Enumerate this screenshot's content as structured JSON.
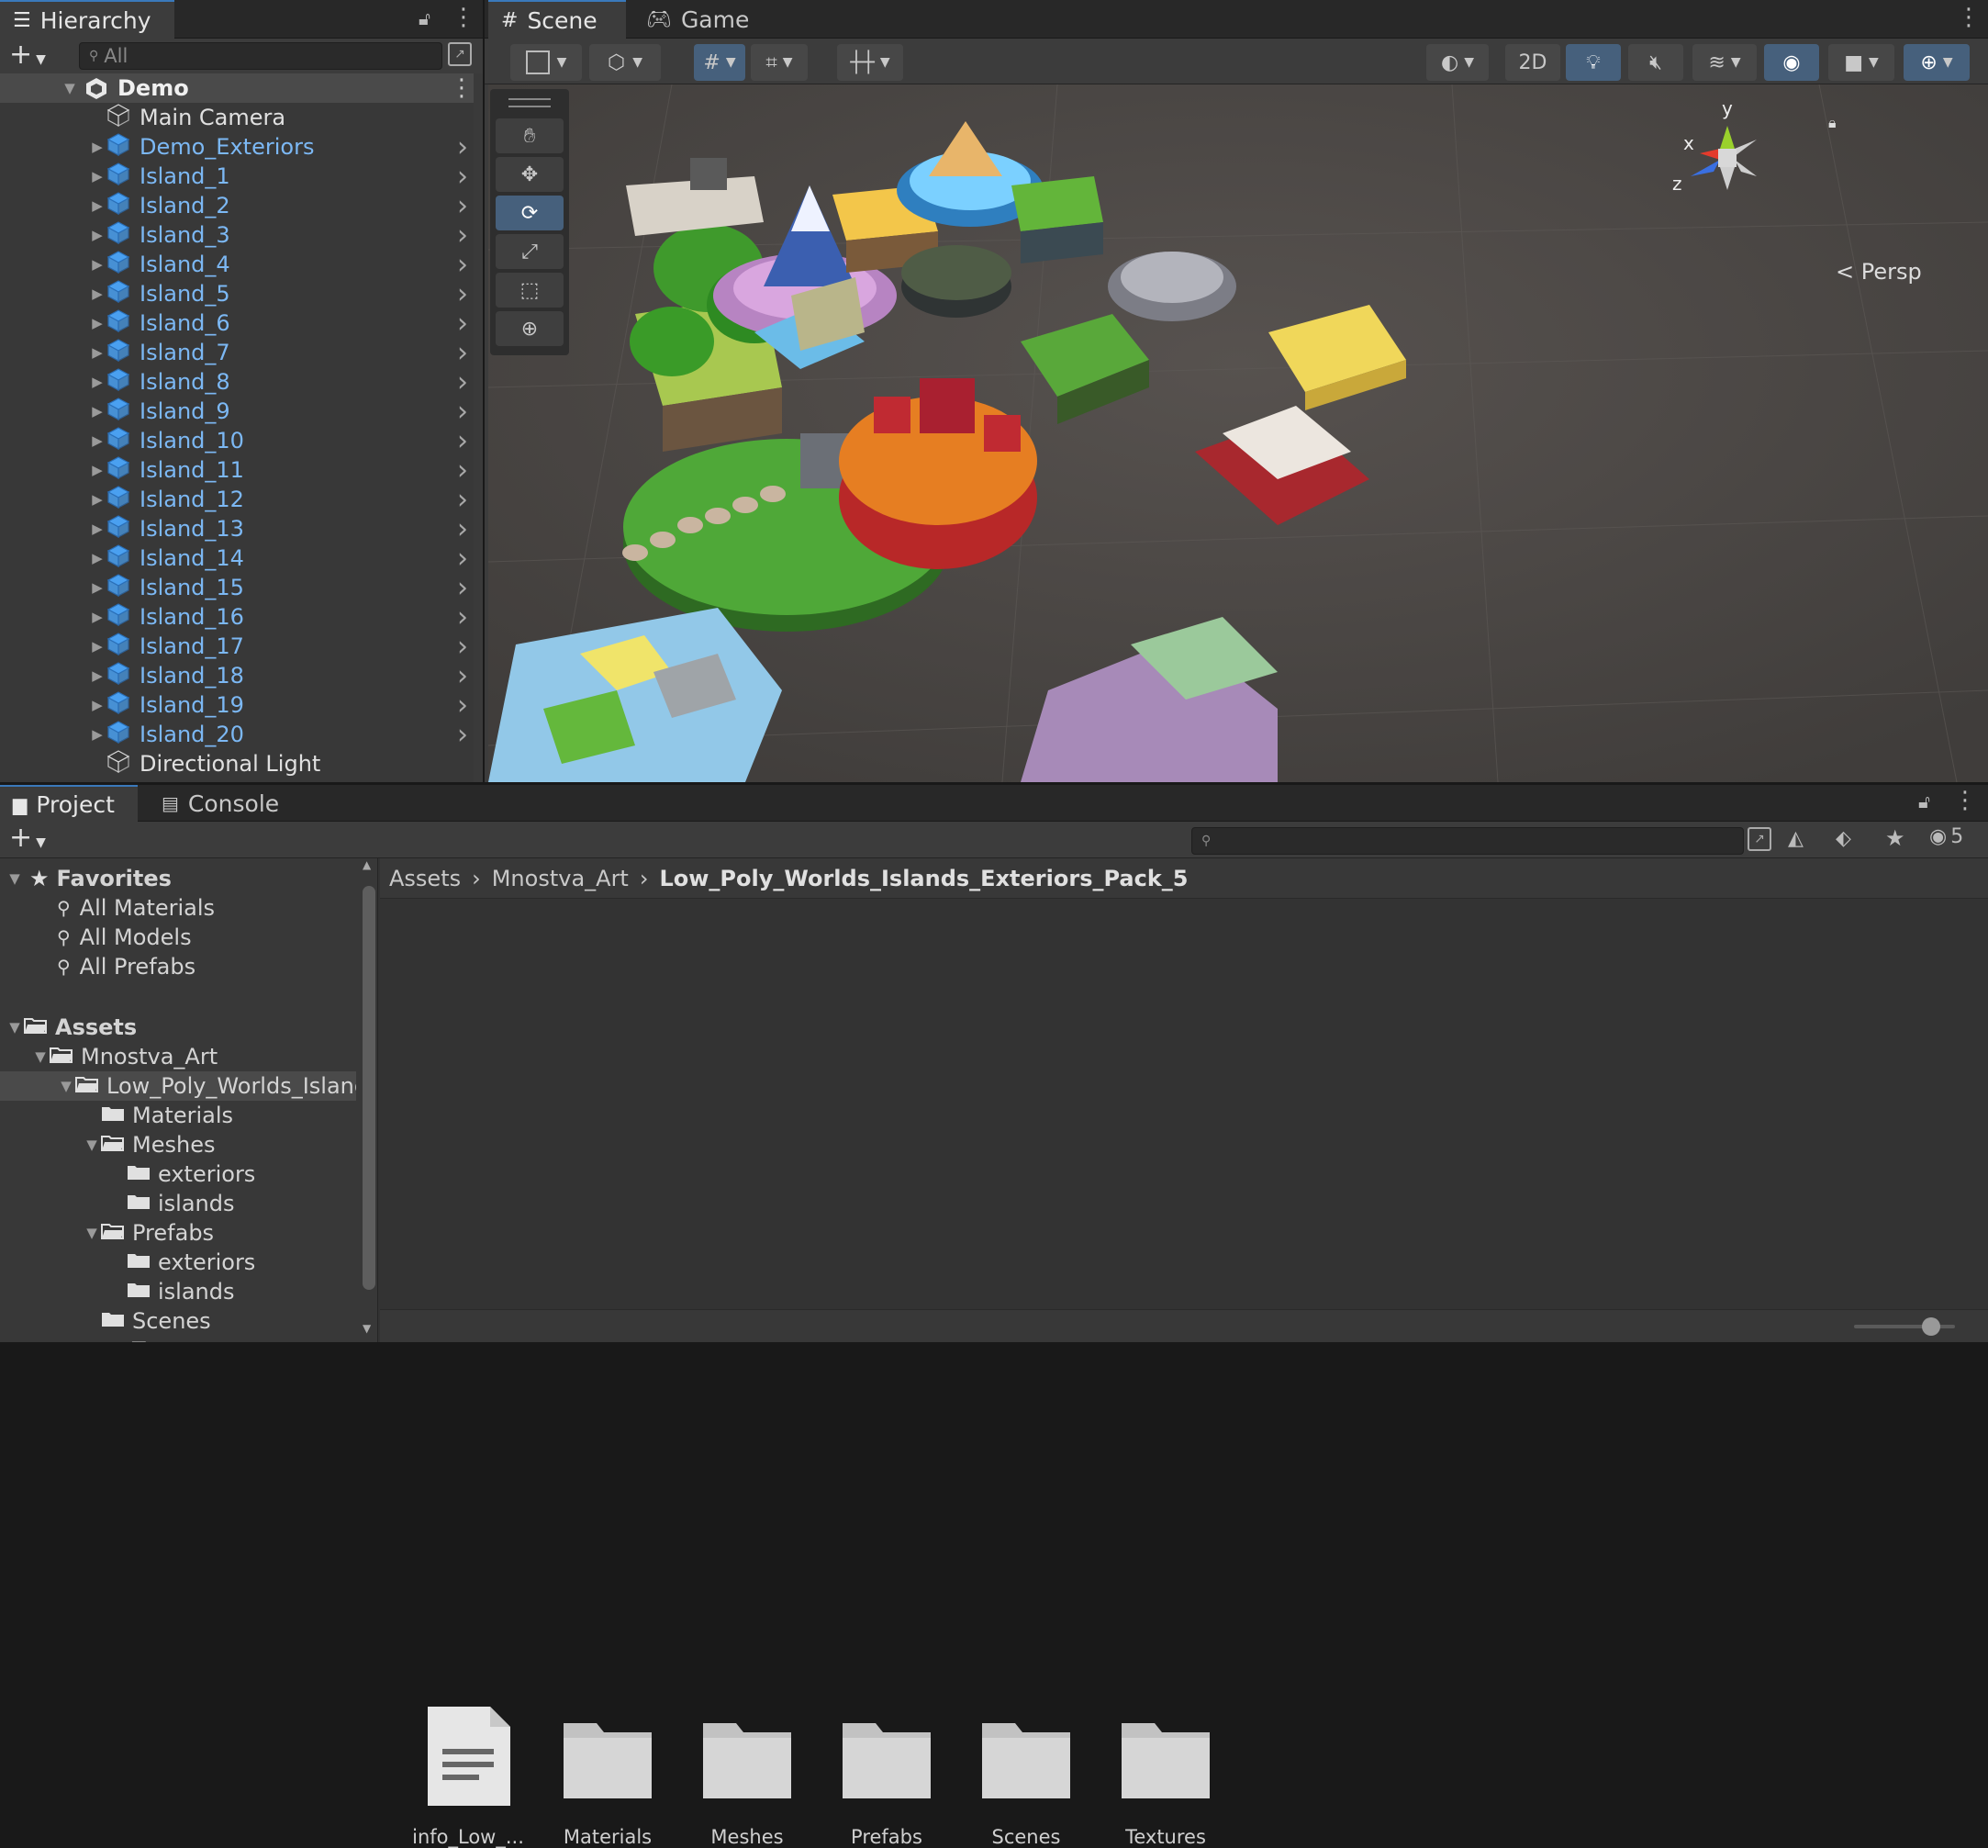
{
  "hierarchy": {
    "tab_label": "Hierarchy",
    "search_placeholder": "All",
    "root": "Demo",
    "items": [
      {
        "label": "Main Camera",
        "kind": "white"
      },
      {
        "label": "Demo_Exteriors",
        "kind": "prefab"
      },
      {
        "label": "Island_1",
        "kind": "prefab"
      },
      {
        "label": "Island_2",
        "kind": "prefab"
      },
      {
        "label": "Island_3",
        "kind": "prefab"
      },
      {
        "label": "Island_4",
        "kind": "prefab"
      },
      {
        "label": "Island_5",
        "kind": "prefab"
      },
      {
        "label": "Island_6",
        "kind": "prefab"
      },
      {
        "label": "Island_7",
        "kind": "prefab"
      },
      {
        "label": "Island_8",
        "kind": "prefab"
      },
      {
        "label": "Island_9",
        "kind": "prefab"
      },
      {
        "label": "Island_10",
        "kind": "prefab"
      },
      {
        "label": "Island_11",
        "kind": "prefab"
      },
      {
        "label": "Island_12",
        "kind": "prefab"
      },
      {
        "label": "Island_13",
        "kind": "prefab"
      },
      {
        "label": "Island_14",
        "kind": "prefab"
      },
      {
        "label": "Island_15",
        "kind": "prefab"
      },
      {
        "label": "Island_16",
        "kind": "prefab"
      },
      {
        "label": "Island_17",
        "kind": "prefab"
      },
      {
        "label": "Island_18",
        "kind": "prefab"
      },
      {
        "label": "Island_19",
        "kind": "prefab"
      },
      {
        "label": "Island_20",
        "kind": "prefab"
      },
      {
        "label": "Directional Light",
        "kind": "white"
      }
    ]
  },
  "scene": {
    "tabs": [
      "Scene",
      "Game"
    ],
    "btn_2d": "2D",
    "gizmo": {
      "x": "x",
      "y": "y",
      "z": "z",
      "persp": "< Persp"
    }
  },
  "project": {
    "tabs": [
      "Project",
      "Console"
    ],
    "hidden_count": "5",
    "breadcrumb": [
      "Assets",
      "Mnostva_Art",
      "Low_Poly_Worlds_Islands_Exteriors_Pack_5"
    ],
    "favorites": {
      "label": "Favorites",
      "items": [
        "All Materials",
        "All Models",
        "All Prefabs"
      ]
    },
    "tree": [
      {
        "label": "Assets",
        "depth": 0,
        "arrow": "down",
        "open": true,
        "bold": true
      },
      {
        "label": "Mnostva_Art",
        "depth": 1,
        "arrow": "down",
        "open": true
      },
      {
        "label": "Low_Poly_Worlds_Islands_Exteriors_Pack_5",
        "depth": 2,
        "arrow": "down",
        "open": true,
        "selected": true
      },
      {
        "label": "Materials",
        "depth": 3,
        "arrow": ""
      },
      {
        "label": "Meshes",
        "depth": 3,
        "arrow": "down",
        "open": true
      },
      {
        "label": "exteriors",
        "depth": 4,
        "arrow": ""
      },
      {
        "label": "islands",
        "depth": 4,
        "arrow": ""
      },
      {
        "label": "Prefabs",
        "depth": 3,
        "arrow": "down",
        "open": true
      },
      {
        "label": "exteriors",
        "depth": 4,
        "arrow": ""
      },
      {
        "label": "islands",
        "depth": 4,
        "arrow": ""
      },
      {
        "label": "Scenes",
        "depth": 3,
        "arrow": ""
      },
      {
        "label": "Textures",
        "depth": 3,
        "arrow": ""
      }
    ],
    "assets": [
      {
        "label": "info_Low_...",
        "type": "file"
      },
      {
        "label": "Materials",
        "type": "folder"
      },
      {
        "label": "Meshes",
        "type": "folder"
      },
      {
        "label": "Prefabs",
        "type": "folder"
      },
      {
        "label": "Scenes",
        "type": "folder"
      },
      {
        "label": "Textures",
        "type": "folder"
      }
    ],
    "zoom_level": 0.4
  },
  "colors": {
    "accent": "#46607c",
    "prefab_text": "#7cb8f4",
    "prefab_icon": "#4aa0f0"
  }
}
